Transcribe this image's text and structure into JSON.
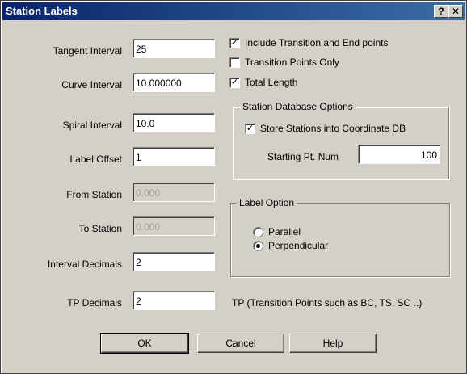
{
  "window": {
    "title": "Station Labels",
    "help_btn": "?",
    "close_btn": "✕"
  },
  "fields": [
    {
      "label": "Tangent Interval",
      "value": "25",
      "enabled": true
    },
    {
      "label": "Curve Interval",
      "value": "10.000000",
      "enabled": true
    },
    {
      "label": "Spiral Interval",
      "value": "10.0",
      "enabled": true
    },
    {
      "label": "Label Offset",
      "value": "1",
      "enabled": true
    },
    {
      "label": "From Station",
      "value": "0.000",
      "enabled": false
    },
    {
      "label": "To Station",
      "value": "0.000",
      "enabled": false
    },
    {
      "label": "Interval Decimals",
      "value": "2",
      "enabled": true
    },
    {
      "label": "TP Decimals",
      "value": "2",
      "enabled": true
    }
  ],
  "checkboxes": [
    {
      "label": "Include Transition and End points",
      "checked": true
    },
    {
      "label": "Transition Points Only",
      "checked": false
    },
    {
      "label": "Total Length",
      "checked": true
    }
  ],
  "station_db": {
    "title": "Station Database Options",
    "store_label": "Store Stations into Coordinate DB",
    "store_checked": true,
    "start_label": "Starting Pt. Num",
    "start_value": "100"
  },
  "label_option": {
    "title": "Label Option",
    "options": [
      {
        "label": "Parallel",
        "selected": false
      },
      {
        "label": "Perpendicular",
        "selected": true
      }
    ]
  },
  "tp_note": "TP (Transition Points such as BC, TS, SC ..)",
  "buttons": {
    "ok": "OK",
    "cancel": "Cancel",
    "help": "Help"
  },
  "colors": {
    "titlebar_start": "#0a246a",
    "titlebar_end": "#3a6ea5",
    "face": "#d4d0c8"
  }
}
